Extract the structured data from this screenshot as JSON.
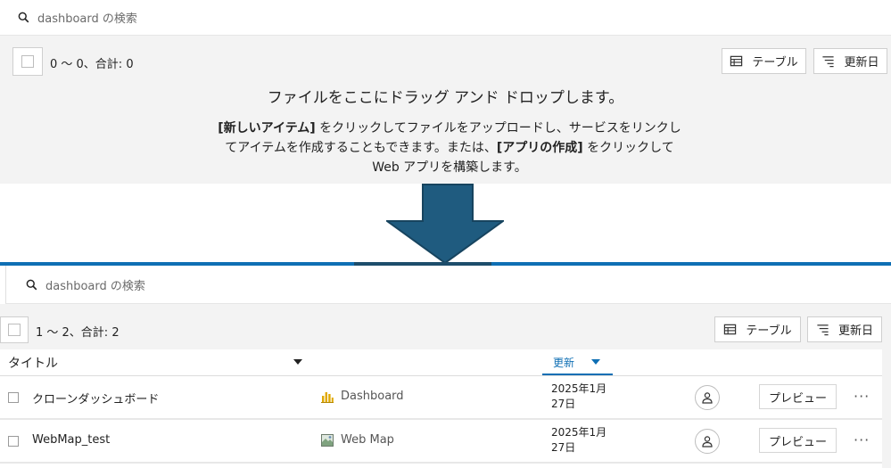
{
  "top_panel": {
    "search_placeholder": "dashboard の検索",
    "count_text": "0 〜 0、合計: 0",
    "table_button": "テーブル",
    "sort_button": "更新日",
    "drop_title": "ファイルをここにドラッグ アンド ドロップします。",
    "drop_desc": {
      "part1_bold": "[新しいアイテム]",
      "part2": " をクリックしてファイルをアップロードし、サービスをリンクしてアイテムを作成することもできます。または、",
      "part3_bold": "[アプリの作成]",
      "part4": " をクリックして Web アプリを構築します。"
    }
  },
  "arrow": {
    "color": "#1f5b7f",
    "stroke": "#17445f"
  },
  "bottom_panel": {
    "search_placeholder": "dashboard の検索",
    "count_text": "1 〜 2、合計: 2",
    "table_button": "テーブル",
    "sort_button": "更新日",
    "columns": {
      "title": "タイトル",
      "updated": "更新"
    },
    "rows": [
      {
        "title": "クローンダッシュボード",
        "type": "Dashboard",
        "type_icon": "dashboard-icon",
        "date_line1": "2025年1月",
        "date_line2": "27日",
        "preview": "プレビュー",
        "more": "···"
      },
      {
        "title": "WebMap_test",
        "type": "Web Map",
        "type_icon": "web-map-icon",
        "date_line1": "2025年1月",
        "date_line2": "27日",
        "preview": "プレビュー",
        "more": "···"
      }
    ]
  },
  "colors": {
    "accent": "#0f6fb4",
    "panel_bg": "#f3f3f3"
  }
}
